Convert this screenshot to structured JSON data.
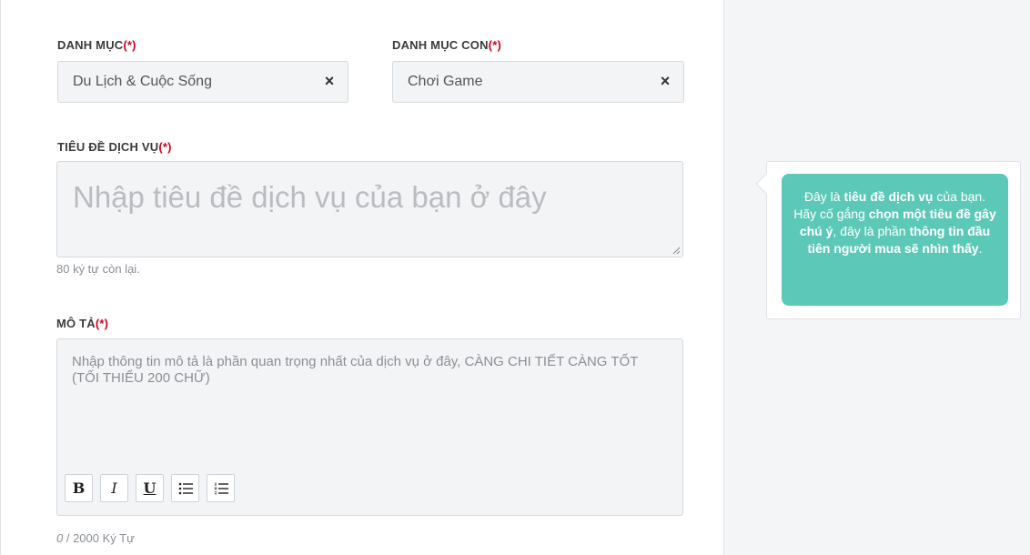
{
  "form": {
    "category_label": "DANH MỤC",
    "category_required": "(*)",
    "category_value": "Du Lịch & Cuộc Sống",
    "subcategory_label": "DANH MỤC CON",
    "subcategory_required": "(*)",
    "subcategory_value": "Chơi Game",
    "clear_icon": "×",
    "title_label": "TIÊU ĐỀ DỊCH VỤ",
    "title_required": "(*)",
    "title_placeholder": "Nhập tiêu đề dịch vụ của bạn ở đây",
    "title_remaining": "80 ký tự còn lại.",
    "desc_label": "MÔ TẢ",
    "desc_required": "(*)",
    "desc_placeholder": "Nhập thông tin mô tả là phần quan trọng nhất của dịch vụ ở đây, CÀNG CHI TIẾT CÀNG TỐT (TỐI THIỂU 200 CHỮ)",
    "toolbar": {
      "bold": "B",
      "italic": "I",
      "underline": "U"
    },
    "counter_current": "0",
    "counter_rest": " / 2000 Ký Tự"
  },
  "tooltip": {
    "t1": "Đây là ",
    "t2": "tiêu đề dịch vụ",
    "t3": " của bạn. Hãy cố gắng ",
    "t4": "chọn một tiêu đề gây chú ý",
    "t5": ", đây là phần ",
    "t6": "thông tin đầu tiên người mua sẽ nhìn thấy",
    "t7": "."
  },
  "colors": {
    "required": "#d0021b",
    "tooltip_bg": "#5cc9b8",
    "input_bg": "#f3f4f6"
  },
  "icons": [
    "clear-icon",
    "bold-icon",
    "italic-icon",
    "underline-icon",
    "bullet-list-icon",
    "numbered-list-icon",
    "resize-grip-icon"
  ]
}
